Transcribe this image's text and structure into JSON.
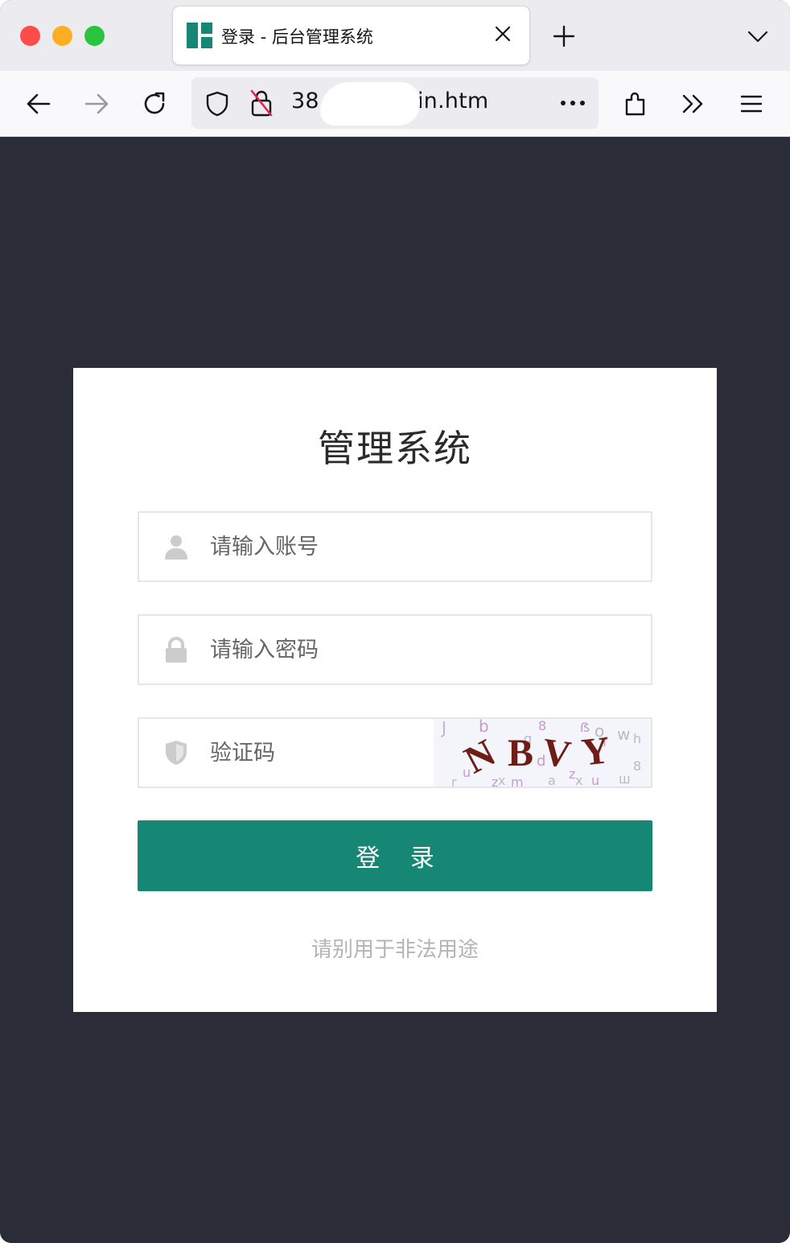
{
  "browser": {
    "tab": {
      "title": "登录 - 后台管理系统",
      "favicon": "layout-favicon-icon"
    },
    "url": {
      "text": "38.            27/admin.htm"
    },
    "colors": {
      "accent_green": "#168775",
      "page_background": "#2a2c37"
    }
  },
  "login": {
    "title": "管理系统",
    "username_placeholder": "请输入账号",
    "password_placeholder": "请输入密码",
    "captcha_placeholder": "验证码",
    "captcha_text": "NBVY",
    "button_label": "登 录",
    "footer_note": "请别用于非法用途"
  }
}
